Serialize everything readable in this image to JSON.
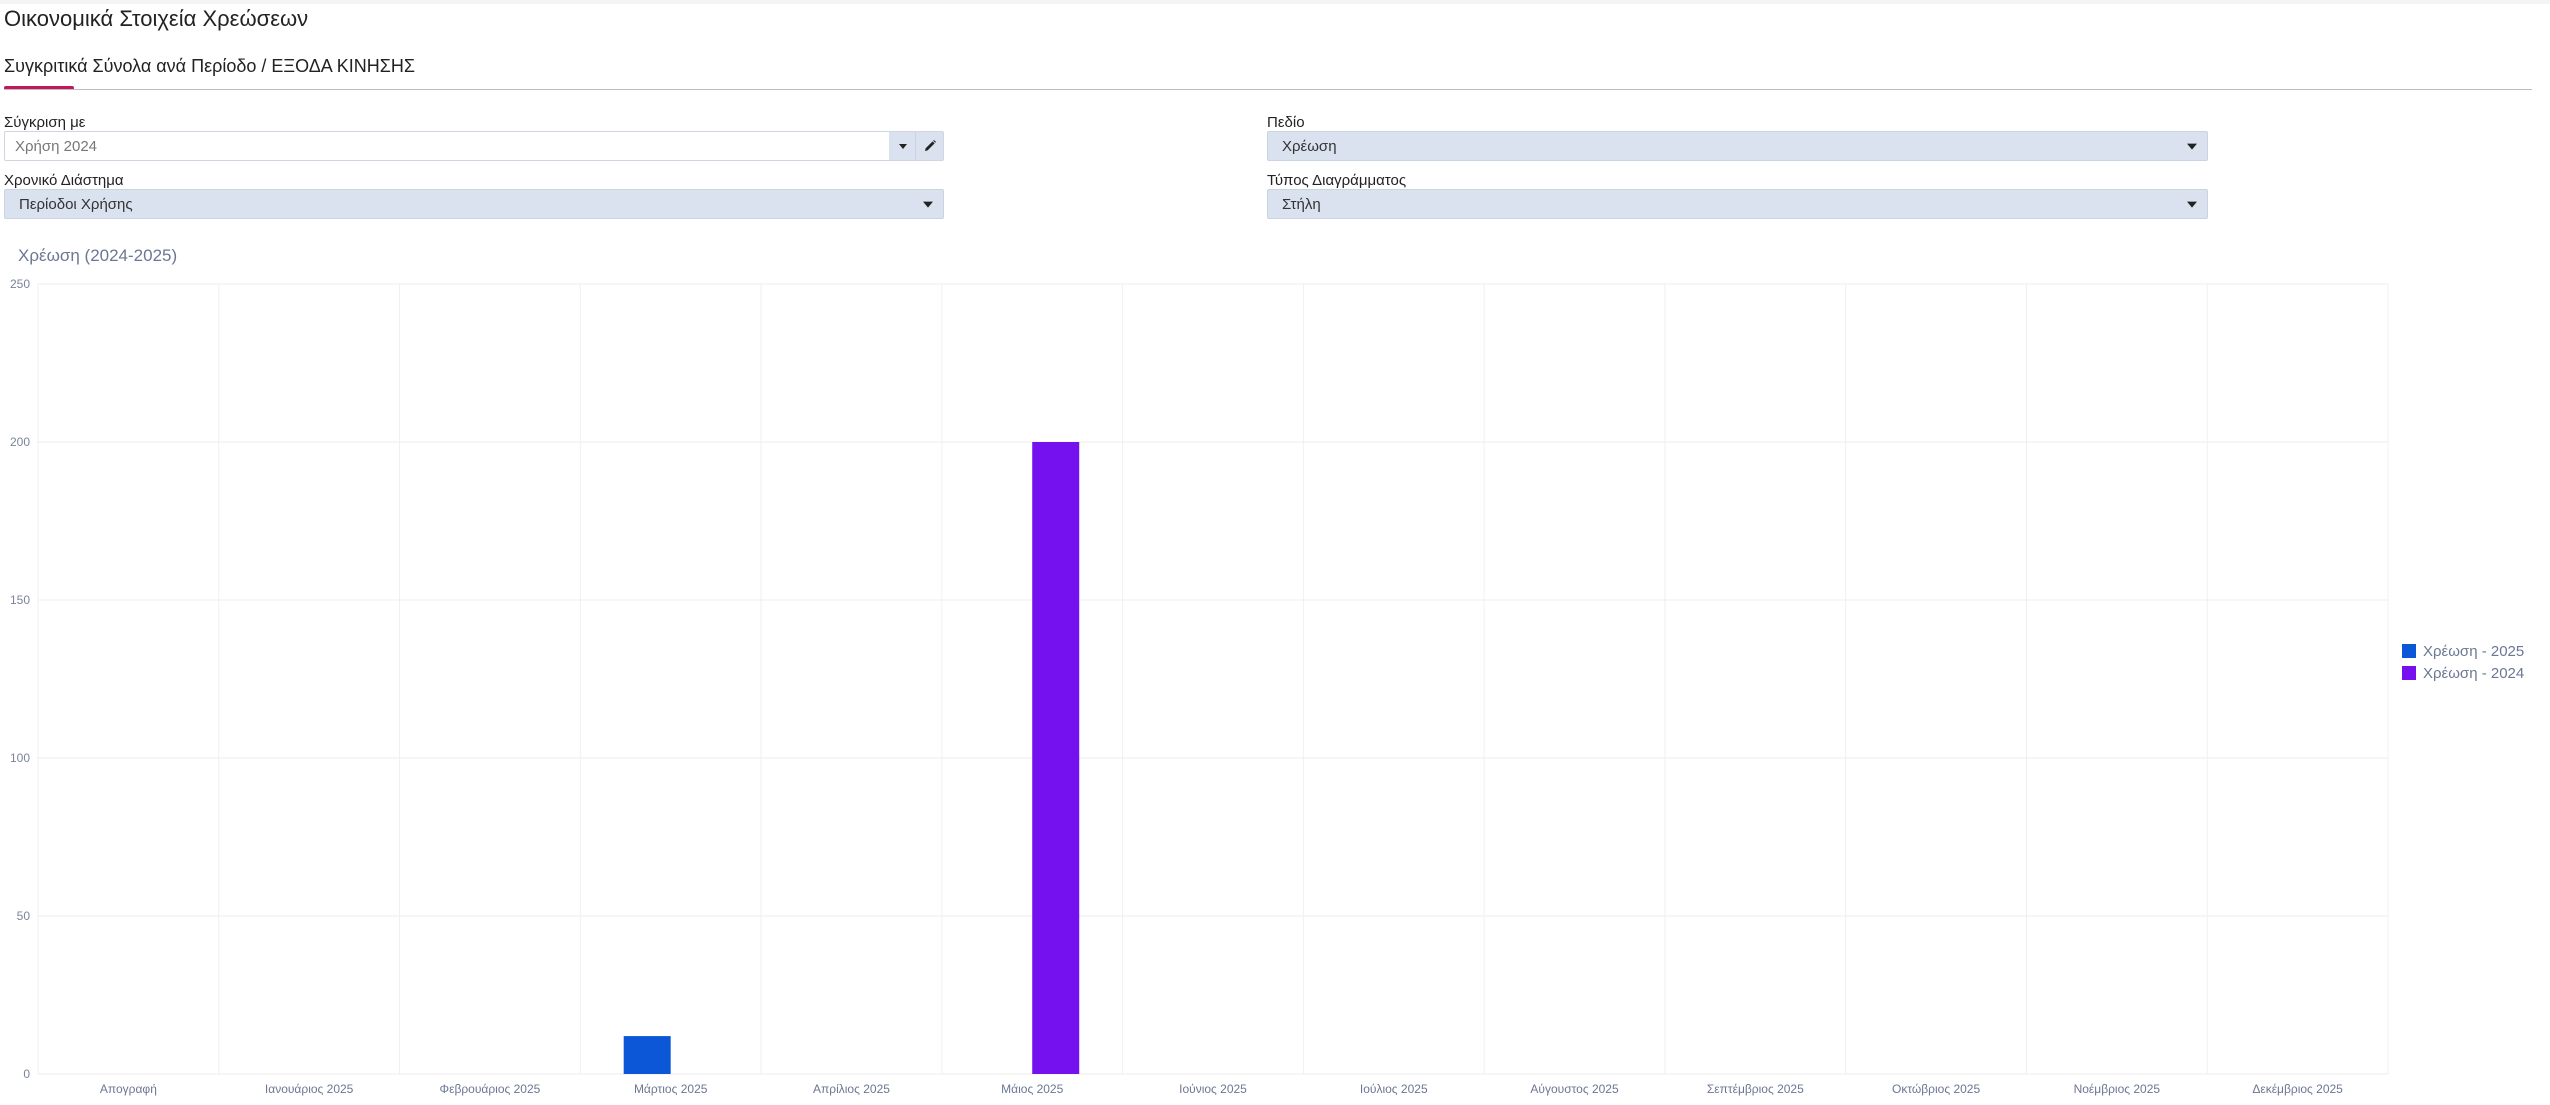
{
  "page": {
    "title": "Οικονομικά Στοιχεία Χρεώσεων",
    "section_title": "Συγκριτικά Σύνολα ανά Περίοδο / ΕΞΟΔΑ ΚΙΝΗΣΗΣ"
  },
  "filters": {
    "compare_label": "Σύγκριση με",
    "compare_value": "Χρήση 2024",
    "period_label": "Χρονικό Διάστημα",
    "period_value": "Περίοδοι Χρήσης",
    "field_label": "Πεδίο",
    "field_value": "Χρέωση",
    "charttype_label": "Τύπος Διαγράμματος",
    "charttype_value": "Στήλη"
  },
  "colors": {
    "accent": "#c2185b",
    "series_2025": "#0b57d8",
    "series_2024": "#7510ee"
  },
  "icons": {
    "dropdown": "chevron-down-icon",
    "edit": "pencil-icon"
  },
  "chart_data": {
    "type": "bar",
    "title": "Χρέωση (2024-2025)",
    "xlabel": "",
    "ylabel": "",
    "ylim": [
      0,
      250
    ],
    "yticks": [
      0,
      50,
      100,
      150,
      200,
      250
    ],
    "grid": true,
    "legend_position": "right",
    "categories": [
      "Απογραφή",
      "Ιανουάριος 2025",
      "Φεβρουάριος 2025",
      "Μάρτιος 2025",
      "Απρίλιος 2025",
      "Μάιος 2025",
      "Ιούνιος 2025",
      "Ιούλιος 2025",
      "Αύγουστος 2025",
      "Σεπτέμβριος 2025",
      "Οκτώβριος 2025",
      "Νοέμβριος 2025",
      "Δεκέμβριος 2025"
    ],
    "series": [
      {
        "name": "Χρέωση - 2025",
        "color": "#0b57d8",
        "values": [
          0,
          0,
          0,
          12,
          0,
          0,
          0,
          0,
          0,
          0,
          0,
          0,
          0
        ]
      },
      {
        "name": "Χρέωση - 2024",
        "color": "#7510ee",
        "values": [
          0,
          0,
          0,
          0,
          0,
          200,
          0,
          0,
          0,
          0,
          0,
          0,
          0
        ]
      }
    ]
  }
}
